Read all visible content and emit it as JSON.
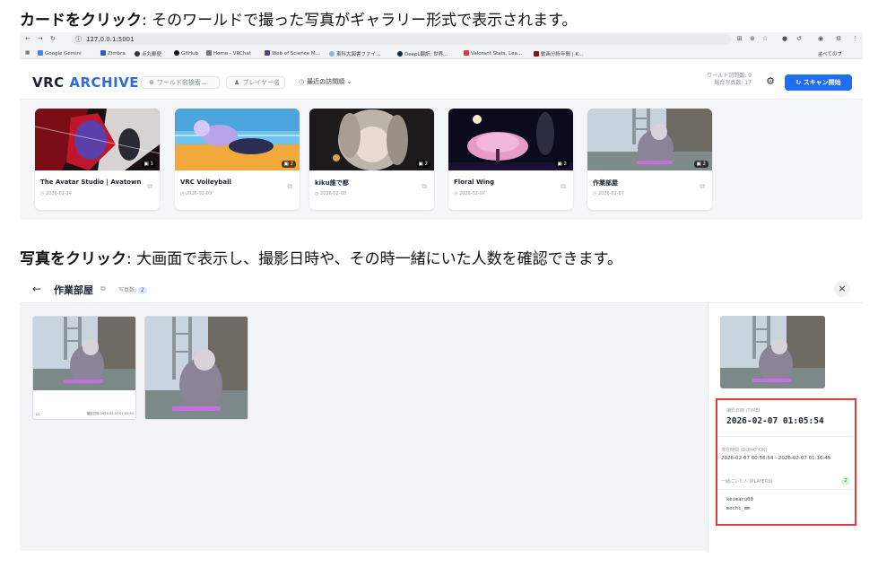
{
  "captions": {
    "card_bold": "カードをクリック",
    "card_rest": ": そのワールドで撮った写真がギャラリー形式で表示されます。",
    "photo_bold": "写真をクリック",
    "photo_rest": ": 大画面で表示し、撮影日時や、その時一緒にいた人数を確認できます。"
  },
  "browser": {
    "url": "127.0.0.1:5001",
    "bookmarks": [
      "Google Gemini",
      "Zimbra",
      "点丸郵便",
      "GitHub",
      "Home - VRChat",
      "Web of Science M...",
      "東科大図書ファイ...",
      "DeepL翻訳: 世界...",
      "Valorant Stats, Lea...",
      "動画分析年間 | K..."
    ],
    "all_bookmarks": "すべてのブ"
  },
  "header": {
    "logo_a": "VRC ",
    "logo_b": "ARCHIVE",
    "world_search_placeholder": "ワールド名検索...",
    "player_placeholder": "プレイヤー名",
    "sort_label": "最近の訪問順",
    "stat_worlds": "ワールド訪問数: 9",
    "stat_photos": "総合写真数: 17",
    "scan_button": "スキャン開始"
  },
  "cards": [
    {
      "title": "The Avatar Studio | Avatown",
      "date": "2026-02-14",
      "count": "1"
    },
    {
      "title": "VRC Volleyball",
      "date": "2026-02-09",
      "count": "2"
    },
    {
      "title": "kiku誰で都",
      "date": "2026-02-08",
      "count": "2"
    },
    {
      "title": "Floral Wing",
      "date": "2026-02-07",
      "count": "2"
    },
    {
      "title": "作業部屋",
      "date": "2026-02-07",
      "count": "2"
    }
  ],
  "detail": {
    "title": "作業部屋",
    "photo_count_label": "写真数:",
    "photo_count": "2",
    "caption_left": "1/2",
    "caption_right": "撮影日時 2026-02-07 01:05:54"
  },
  "info": {
    "shot_label": "撮影日時 (TIME)",
    "shot_value": "2026-02-07 01:05:54",
    "duration_label": "滞在時間 (DURATION)",
    "duration_value": "2026-02-07 00:56:54 - 2026-02-07 01:16:45",
    "players_label": "一緒にいた人 (PLAYERS)",
    "players_count": "2",
    "players": [
      "keimaru00",
      "mochi_mm"
    ]
  },
  "colors": {
    "accent": "#1e6df2",
    "logo_blue": "#2f6bdc",
    "highlight": "#e23b3b"
  }
}
